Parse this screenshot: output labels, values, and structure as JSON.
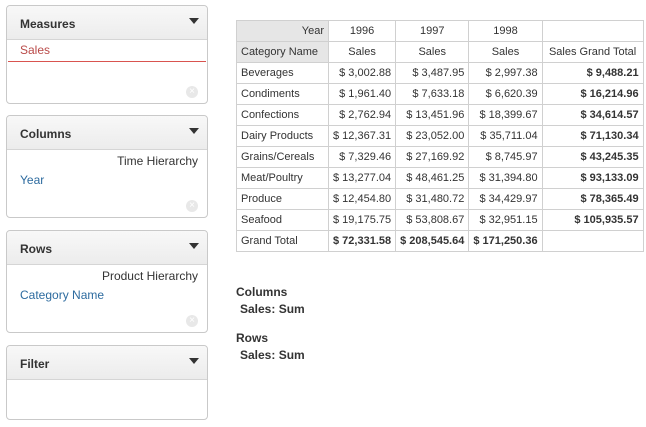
{
  "panels": {
    "measures": {
      "title": "Measures",
      "items": [
        "Sales"
      ]
    },
    "columns": {
      "title": "Columns",
      "hierarchy": "Time Hierarchy",
      "items": [
        "Year"
      ]
    },
    "rows": {
      "title": "Rows",
      "hierarchy": "Product Hierarchy",
      "items": [
        "Category Name"
      ]
    },
    "filter": {
      "title": "Filter"
    },
    "remove_icon": "x-circle-icon"
  },
  "pivot": {
    "col_axis_label": "Year",
    "row_axis_label": "Category Name",
    "years": [
      "1996",
      "1997",
      "1998"
    ],
    "measure_label": "Sales",
    "grand_total_col_label": "Sales Grand Total",
    "rows": [
      {
        "name": "Beverages",
        "values": [
          "$ 3,002.88",
          "$ 3,487.95",
          "$ 2,997.38"
        ],
        "total": "$ 9,488.21"
      },
      {
        "name": "Condiments",
        "values": [
          "$ 1,961.40",
          "$ 7,633.18",
          "$ 6,620.39"
        ],
        "total": "$ 16,214.96"
      },
      {
        "name": "Confections",
        "values": [
          "$ 2,762.94",
          "$ 13,451.96",
          "$ 18,399.67"
        ],
        "total": "$ 34,614.57"
      },
      {
        "name": "Dairy Products",
        "values": [
          "$ 12,367.31",
          "$ 23,052.00",
          "$ 35,711.04"
        ],
        "total": "$ 71,130.34"
      },
      {
        "name": "Grains/Cereals",
        "values": [
          "$ 7,329.46",
          "$ 27,169.92",
          "$ 8,745.97"
        ],
        "total": "$ 43,245.35"
      },
      {
        "name": "Meat/Poultry",
        "values": [
          "$ 13,277.04",
          "$ 48,461.25",
          "$ 31,394.80"
        ],
        "total": "$ 93,133.09"
      },
      {
        "name": "Produce",
        "values": [
          "$ 12,454.80",
          "$ 31,480.72",
          "$ 34,429.97"
        ],
        "total": "$ 78,365.49"
      },
      {
        "name": "Seafood",
        "values": [
          "$ 19,175.75",
          "$ 53,808.67",
          "$ 32,951.15"
        ],
        "total": "$ 105,935.57"
      }
    ],
    "grand_total": {
      "label": "Grand Total",
      "values": [
        "$ 72,331.58",
        "$ 208,545.64",
        "$ 171,250.36"
      ],
      "total": ""
    }
  },
  "summary": {
    "columns_title": "Columns",
    "columns_value": "Sales: Sum",
    "rows_title": "Rows",
    "rows_value": "Sales: Sum"
  }
}
